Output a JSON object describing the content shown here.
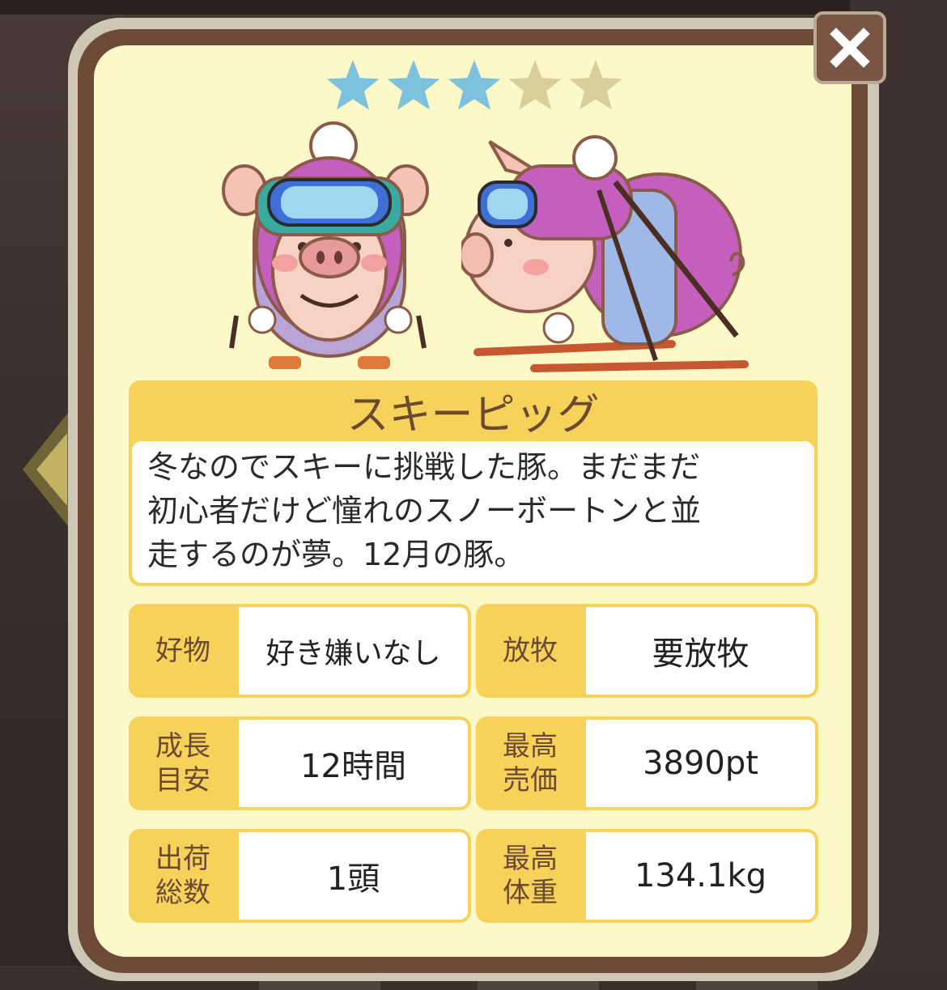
{
  "rating": {
    "filled": 3,
    "total": 5,
    "filled_color": "#7cc2dc",
    "empty_color": "#d8cf9a"
  },
  "pig": {
    "name": "スキーピッグ",
    "description": "冬なのでスキーに挑戦した豚。まだまだ\n初心者だけど憧れのスノーボートンと並\n走するのが夢。12月の豚。"
  },
  "stats": [
    {
      "label": "好物",
      "value": "好き嫌いなし"
    },
    {
      "label": "放牧",
      "value": "要放牧"
    },
    {
      "label": "成長\n目安",
      "value": "12時間"
    },
    {
      "label": "最高\n売価",
      "value": "3890pt"
    },
    {
      "label": "出荷\n総数",
      "value": "1頭"
    },
    {
      "label": "最高\n体重",
      "value": "134.1kg"
    }
  ],
  "icons": {
    "close": "close-icon",
    "prev": "left-arrow-icon"
  },
  "colors": {
    "panel_bg": "#fdf8c8",
    "label_bg": "#f6d25a",
    "frame": "#6e4a38",
    "text_brown": "#6b4a31"
  }
}
